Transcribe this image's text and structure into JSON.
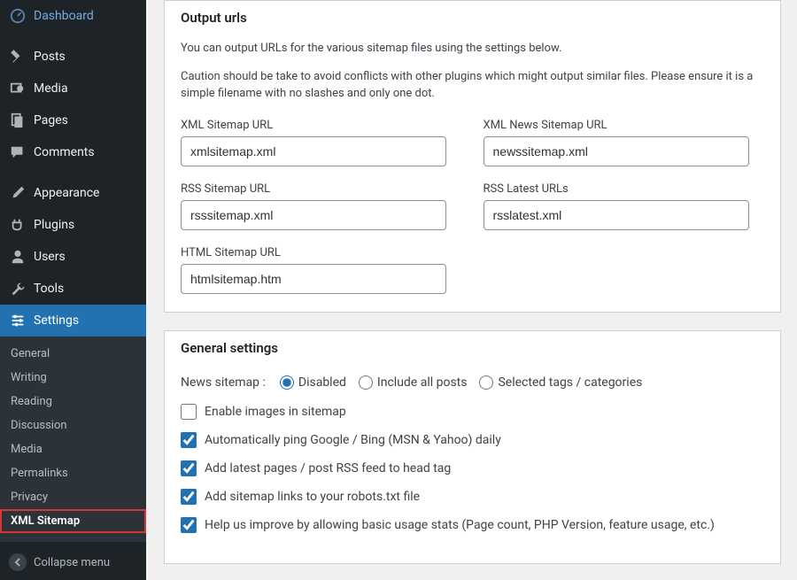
{
  "sidebar": {
    "main": [
      {
        "label": "Dashboard",
        "icon": "dashboard"
      },
      {
        "label": "Posts",
        "icon": "pin"
      },
      {
        "label": "Media",
        "icon": "media"
      },
      {
        "label": "Pages",
        "icon": "pages"
      },
      {
        "label": "Comments",
        "icon": "comment"
      },
      {
        "label": "Appearance",
        "icon": "brush"
      },
      {
        "label": "Plugins",
        "icon": "plug"
      },
      {
        "label": "Users",
        "icon": "user"
      },
      {
        "label": "Tools",
        "icon": "wrench"
      },
      {
        "label": "Settings",
        "icon": "sliders",
        "active": true
      }
    ],
    "submenu": [
      {
        "label": "General"
      },
      {
        "label": "Writing"
      },
      {
        "label": "Reading"
      },
      {
        "label": "Discussion"
      },
      {
        "label": "Media"
      },
      {
        "label": "Permalinks"
      },
      {
        "label": "Privacy"
      },
      {
        "label": "XML Sitemap",
        "current": true
      }
    ],
    "collapse": "Collapse menu"
  },
  "output_urls": {
    "title": "Output urls",
    "desc1": "You can output URLs for the various sitemap files using the settings below.",
    "desc2": "Caution should be take to avoid conflicts with other plugins which might output similar files. Please ensure it is a simple filename with no slashes and only one dot.",
    "fields": {
      "xml": {
        "label": "XML Sitemap URL",
        "value": "xmlsitemap.xml"
      },
      "xmlnews": {
        "label": "XML News Sitemap URL",
        "value": "newssitemap.xml"
      },
      "rss": {
        "label": "RSS Sitemap URL",
        "value": "rsssitemap.xml"
      },
      "rsslatest": {
        "label": "RSS Latest URLs",
        "value": "rsslatest.xml"
      },
      "html": {
        "label": "HTML Sitemap URL",
        "value": "htmlsitemap.htm"
      }
    }
  },
  "general": {
    "title": "General settings",
    "news_prefix": "News sitemap :",
    "radios": {
      "disabled": "Disabled",
      "include": "Include all posts",
      "selected": "Selected tags / categories"
    },
    "checks": {
      "images": "Enable images in sitemap",
      "ping": "Automatically ping Google / Bing (MSN & Yahoo) daily",
      "rssfeed": "Add latest pages / post RSS feed to head tag",
      "robots": "Add sitemap links to your robots.txt file",
      "stats": "Help us improve by allowing basic usage stats (Page count, PHP Version, feature usage, etc.)"
    }
  }
}
